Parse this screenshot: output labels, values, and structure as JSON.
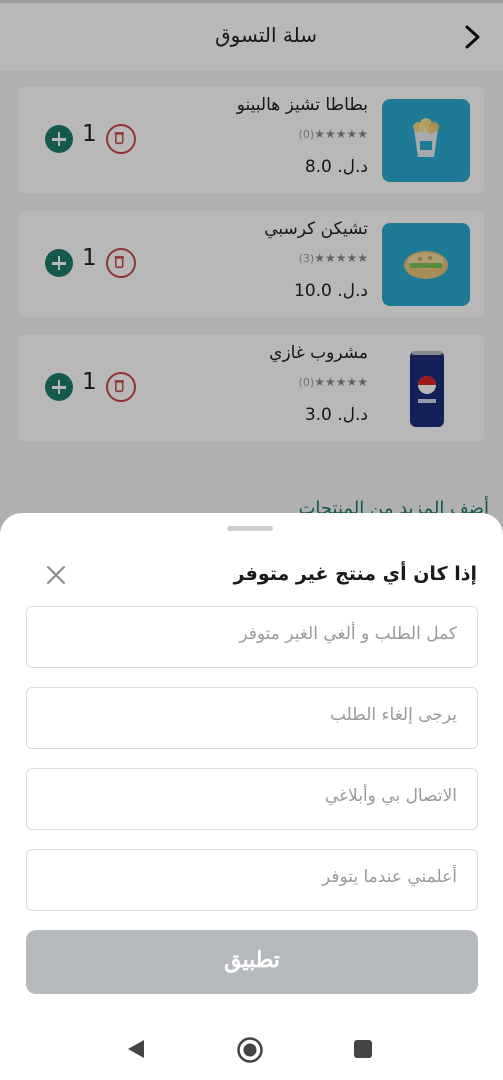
{
  "header": {
    "title": "سلة التسوق"
  },
  "cart_items": [
    {
      "name": "بطاطا تشيز هالبينو",
      "stars": "★★★★★",
      "reviews": "(0)",
      "price": "د.ل. 8.0",
      "quantity": "1"
    },
    {
      "name": "تشيكن كرسبي",
      "stars": "★★★★★",
      "reviews": "(3)",
      "price": "د.ل. 10.0",
      "quantity": "1"
    },
    {
      "name": "مشروب غازي",
      "stars": "★★★★★",
      "reviews": "(0)",
      "price": "د.ل. 3.0",
      "quantity": "1"
    }
  ],
  "add_more_label": "أضف المزيد من المنتجات",
  "sheet": {
    "title": "إذا كان أي منتج غير متوفر",
    "options": [
      {
        "label": "كمل الطلب و ألغي الغير متوفر"
      },
      {
        "label": "يرجى إلغاء الطلب"
      },
      {
        "label": "الاتصال بي وأبلاغي"
      },
      {
        "label": "أعلمني عندما يتوفر"
      }
    ],
    "apply_label": "تطبيق"
  },
  "colors": {
    "accent": "#1d7a6c",
    "delete": "#c84a4a",
    "apply_disabled": "#b5b9be",
    "thumb_blue": "#2aa9cf"
  },
  "icons": {
    "back": "chevron-right-icon",
    "close": "close-icon",
    "plus": "plus-circle-icon",
    "delete": "trash-icon"
  }
}
